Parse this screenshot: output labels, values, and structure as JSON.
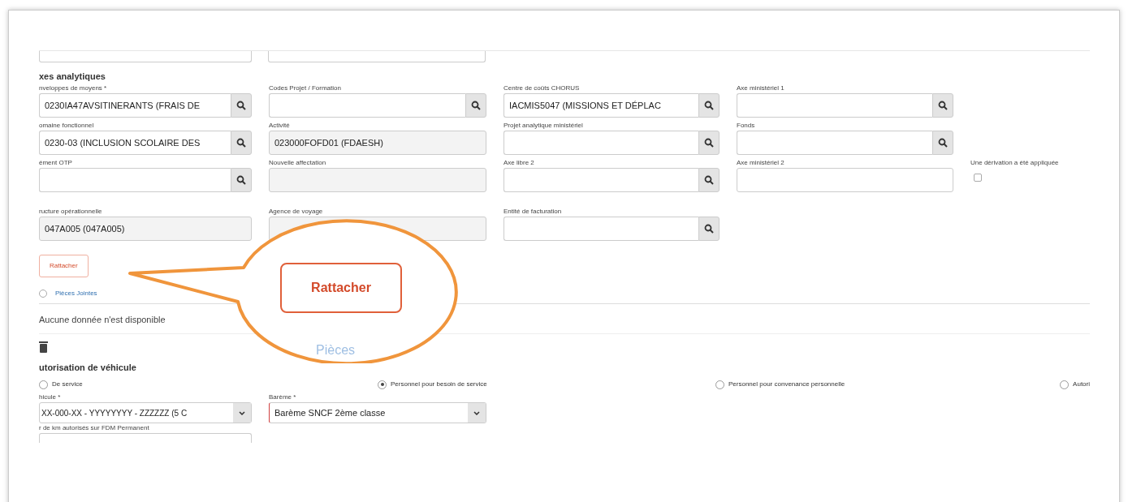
{
  "axes_section": {
    "title": "xes analytiques",
    "rows": [
      [
        {
          "label": "nveloppes de moyens *",
          "value": "0230IA47AVSITINERANTS (FRAIS DE",
          "search": true,
          "readonly": false
        },
        {
          "label": "Codes Projet / Formation",
          "search": true,
          "readonly": false
        },
        {
          "label": "Centre de coûts CHORUS",
          "value": "IACMIS5047 (MISSIONS ET DÉPLAC",
          "search": true,
          "readonly": false
        },
        {
          "label": "Axe ministériel 1",
          "search": true,
          "readonly": false
        }
      ],
      [
        {
          "label": "omaine fonctionnel",
          "value": "0230-03 (INCLUSION SCOLAIRE DES",
          "search": true,
          "readonly": false
        },
        {
          "label": "Activité",
          "value": "023000FOFD01 (FDAESH)",
          "search": false,
          "readonly": true
        },
        {
          "label": "Projet analytique ministériel",
          "search": true,
          "readonly": false
        },
        {
          "label": "Fonds",
          "search": true,
          "readonly": false
        }
      ],
      [
        {
          "label": "ément OTP",
          "search": true,
          "readonly": false
        },
        {
          "label": "Nouvelle affectation",
          "search": false,
          "readonly": true
        },
        {
          "label": "Axe libre 2",
          "search": true,
          "readonly": false
        },
        {
          "label": "Axe ministériel 2",
          "search": false,
          "readonly": false
        }
      ],
      [
        {
          "label": "ructure opérationnelle",
          "value": "047A005 (047A005)",
          "search": false,
          "readonly": true
        },
        {
          "label": "Agence de voyage",
          "search": false,
          "readonly": true
        },
        {
          "label": "Entité de facturation",
          "search": true,
          "readonly": false
        }
      ]
    ],
    "derivation": {
      "label": "Une dérivation a été appliquée",
      "checked": false
    },
    "attach_button": "Rattacher"
  },
  "callout": {
    "button": "Rattacher"
  },
  "attachments": {
    "label": "Pièces Jointes",
    "checked": false,
    "empty_text": "Aucune donnée n'est disponible",
    "faint_text": "Pièces"
  },
  "vehicle_section": {
    "title": "utorisation de véhicule",
    "options": [
      {
        "label": "De service",
        "selected": false
      },
      {
        "label": "Personnel pour besoin de service",
        "selected": true
      },
      {
        "label": "Personnel pour convenance personnelle",
        "selected": false
      },
      {
        "label": "Autori",
        "selected": false
      }
    ],
    "vehicle": {
      "label": "hicule *",
      "value": "XX-000-XX - YYYYYYYY - ZZZZZZ (5 C"
    },
    "scale": {
      "label": "Barème *",
      "value": "Barème SNCF 2ème classe"
    },
    "km": {
      "label": "r de km autorisés sur FDM Permanent"
    }
  }
}
